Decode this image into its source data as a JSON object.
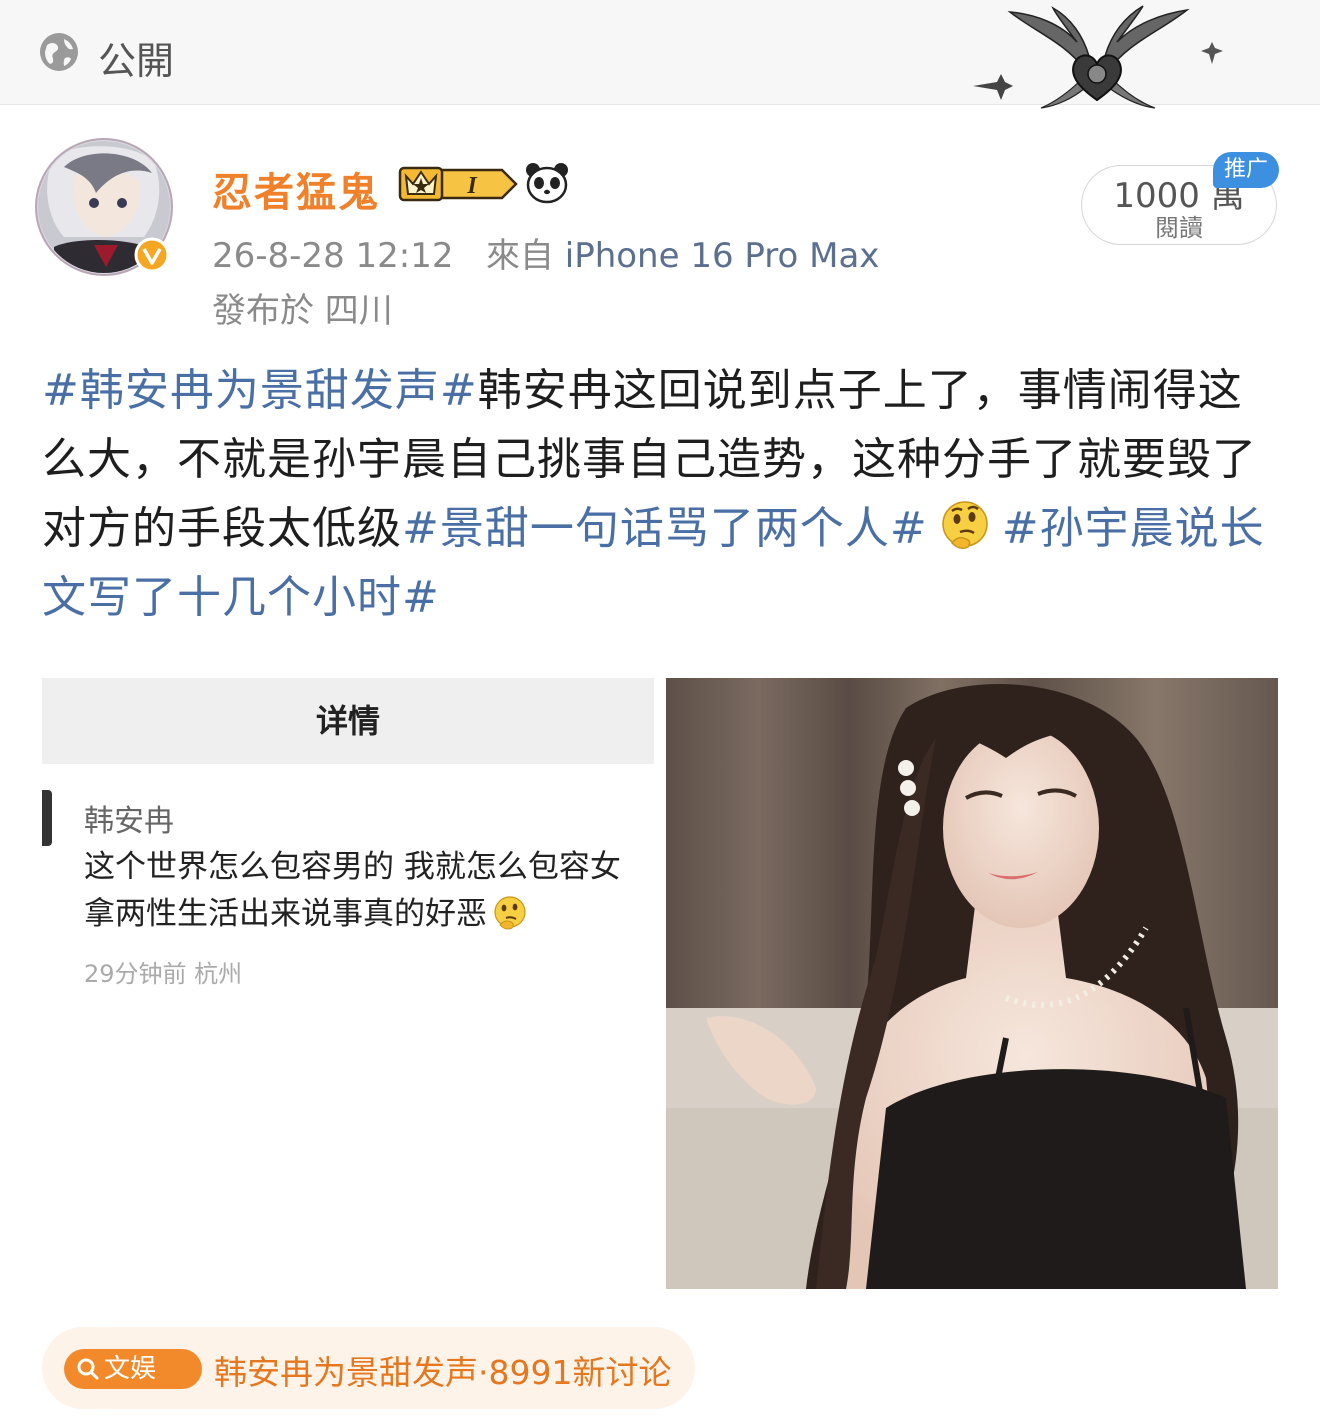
{
  "header": {
    "visibility_label": "公開"
  },
  "author": {
    "name": "忍者猛鬼",
    "level_badge": "I",
    "timestamp": "26-8-28 12:12",
    "source_prefix": "來自",
    "device": "iPhone 16 Pro Max",
    "location": "發布於 四川"
  },
  "read_count": {
    "count": "1000 萬",
    "unit": "閱讀",
    "promo_tag": "推广"
  },
  "post": {
    "seg1": "#韩安冉为景甜发声#",
    "seg2": "韩安冉这回说到点子上了，事情闹得这么大，不就是孙宇晨自己挑事自己造势，这种分手了就要毁了对方的手段太低级",
    "seg3": "#景甜一句话骂了两个人#",
    "seg4": "#孙宇晨说长文写了十几个小时#"
  },
  "screenshot_image": {
    "header": "详情",
    "commenter": "韩安冉",
    "line1": "这个世界怎么包容男的 我就怎么包容女",
    "line2": "拿两性生活出来说事真的好恶",
    "meta": "29分钟前  杭州"
  },
  "topic": {
    "badge": "文娱",
    "text": "韩安冉为景甜发声·8991新讨论"
  },
  "colors": {
    "accent_orange": "#f0802a",
    "hashtag_blue": "#4a6fa5",
    "promo_blue": "#3d8fe0"
  }
}
